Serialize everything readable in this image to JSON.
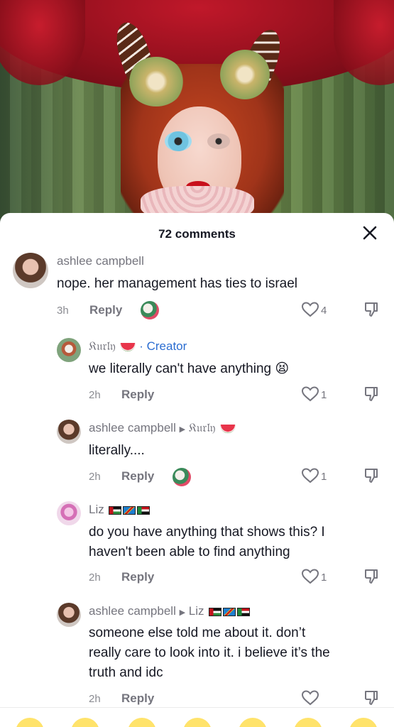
{
  "sheet": {
    "comment_count": "72 comments"
  },
  "comments": [
    {
      "username": "ashlee campbell",
      "text": "nope. her management has ties to israel",
      "time": "3h",
      "reply_label": "Reply",
      "likes": "4"
    },
    {
      "username": "𝔎𝔲𝔯𝔩𝔶",
      "creator_label": "· Creator",
      "text": "we literally can't have anything 😫",
      "time": "2h",
      "reply_label": "Reply",
      "likes": "1"
    },
    {
      "username": "ashlee campbell",
      "reply_to": "𝔎𝔲𝔯𝔩𝔶",
      "text": "literally....",
      "time": "2h",
      "reply_label": "Reply",
      "likes": "1"
    },
    {
      "username": "Liz",
      "text_line1": "do you have anything that shows this? I",
      "text_line2": "haven't been able to find anything",
      "time": "2h",
      "reply_label": "Reply",
      "likes": "1"
    },
    {
      "username": "ashlee campbell",
      "reply_to": "Liz",
      "text_line1": "someone else told me about it. don’t",
      "text_line2": "really care to look into it. i believe it’s the",
      "text_line3": "truth and idc",
      "time": "2h",
      "reply_label": "Reply"
    }
  ],
  "icons": {
    "close": "close-icon",
    "like": "heart-outline-icon",
    "dislike": "thumbs-down-icon"
  },
  "colors": {
    "accent_creator": "#2b6dd1",
    "text_primary": "#161823",
    "text_secondary": "#75757e"
  }
}
